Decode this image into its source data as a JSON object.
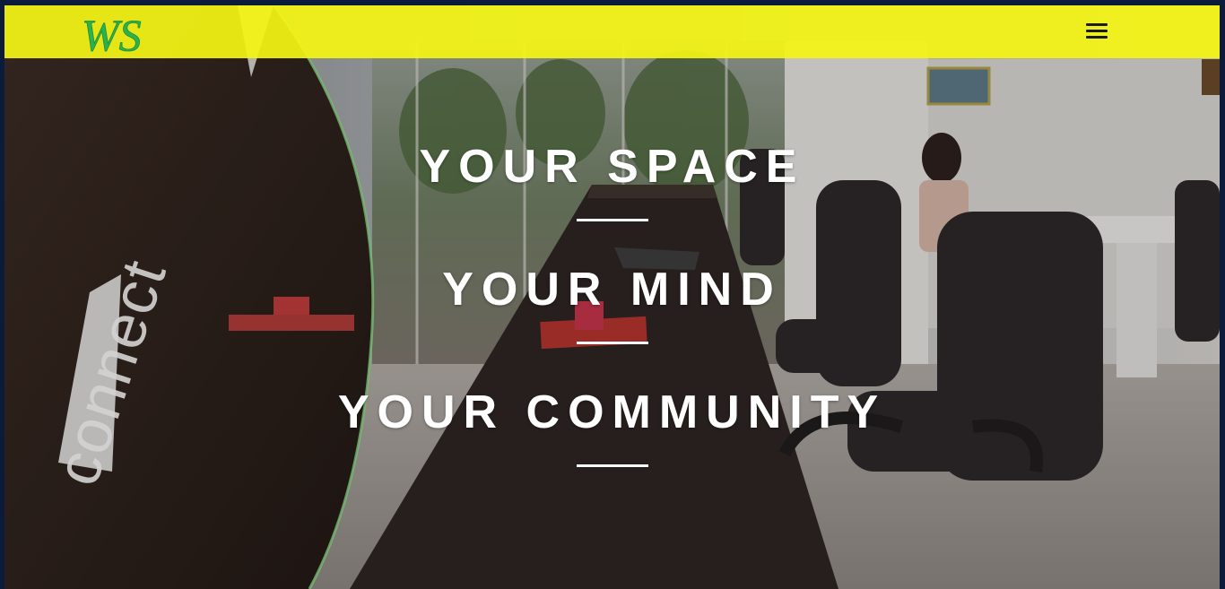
{
  "navbar": {
    "logo_text": "WS",
    "menu_label": "menu",
    "background_color": "#f4f414",
    "logo_color": "#2bb24c"
  },
  "hero": {
    "line1": "YOUR SPACE",
    "line2": "YOUR MIND",
    "line3": "YOUR COMMUNITY"
  },
  "background": {
    "sign_text": "connect"
  },
  "icons": [
    "hamburger-menu-icon"
  ]
}
